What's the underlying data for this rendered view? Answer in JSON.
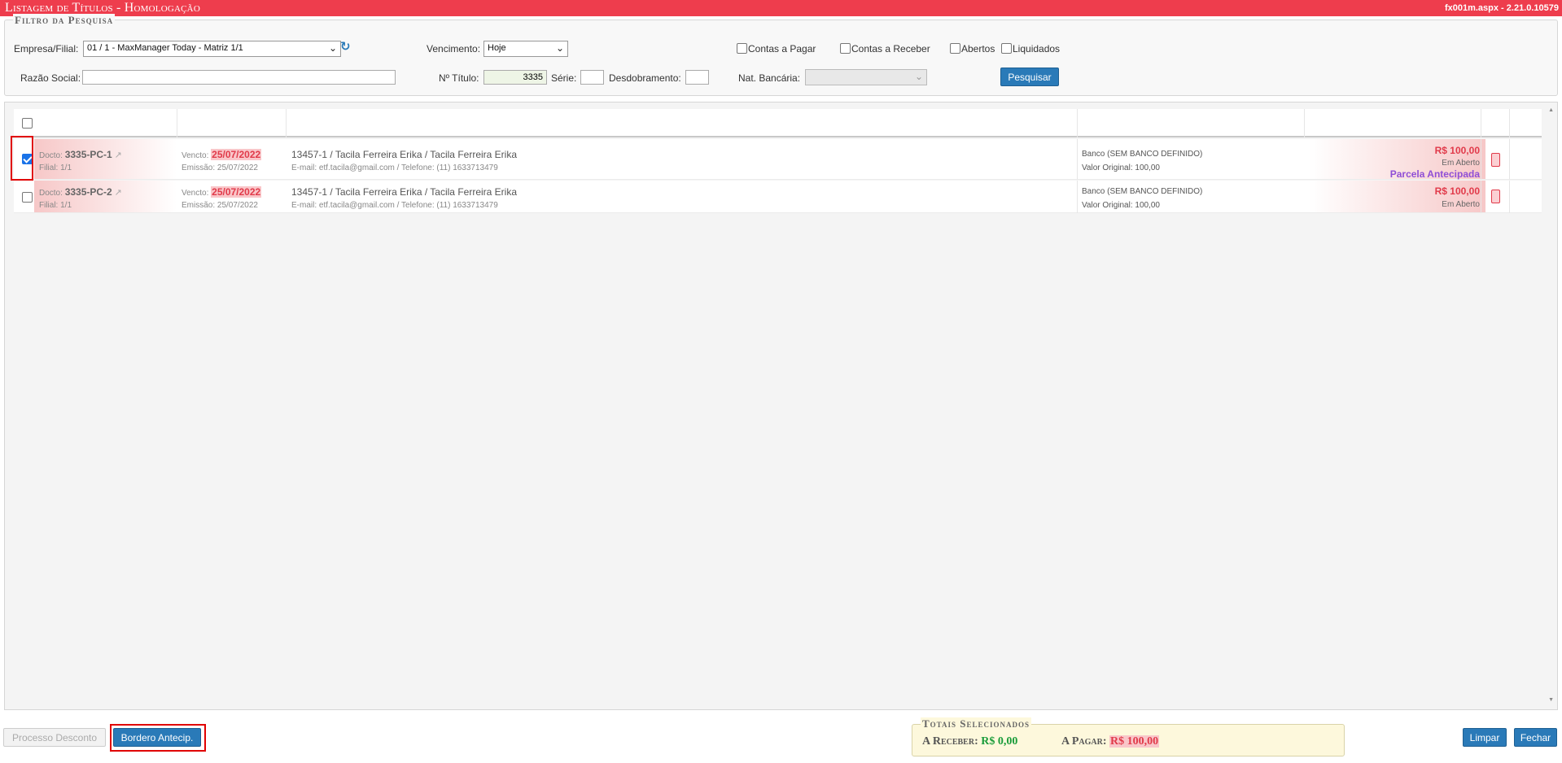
{
  "window": {
    "title": "Listagem de Títulos  - Homologação",
    "version": "fx001m.aspx - 2.21.0.10579"
  },
  "filter": {
    "legend": "Filtro da Pesquisa",
    "empresa_label": "Empresa/Filial:",
    "empresa_value": "01 / 1 - MaxManager Today - Matriz 1/1",
    "vencimento_label": "Vencimento:",
    "vencimento_value": "Hoje",
    "contas_pagar_label": "Contas a Pagar",
    "contas_receber_label": "Contas a Receber",
    "abertos_label": "Abertos",
    "liquidados_label": "Liquidados",
    "razao_label": "Razão Social:",
    "razao_value": "",
    "titulo_label": "Nº Título:",
    "titulo_value": "3335",
    "serie_label": "Série:",
    "serie_value": "",
    "desdobramento_label": "Desdobramento:",
    "desdobramento_value": "",
    "nat_bancaria_label": "Nat. Bancária:",
    "nat_bancaria_value": "",
    "pesquisar_label": "Pesquisar"
  },
  "rows": [
    {
      "selected": true,
      "docto_label": "Docto:",
      "docto": "3335-PC-1",
      "filial": "Filial: 1/1",
      "vencto_label": "Vencto:",
      "vencto": "25/07/2022",
      "emissao": "Emissão: 25/07/2022",
      "cliente": "13457-1 / Tacila Ferreira Erika / Tacila Ferreira Erika",
      "contato": "E-mail: etf.tacila@gmail.com / Telefone: (11) 1633713479",
      "banco": "Banco (SEM BANCO DEFINIDO)",
      "valor_original": "Valor Original: 100,00",
      "valor": "R$ 100,00",
      "status": "Em Aberto",
      "extra": "Parcela Antecipada"
    },
    {
      "selected": false,
      "docto_label": "Docto:",
      "docto": "3335-PC-2",
      "filial": "Filial: 1/1",
      "vencto_label": "Vencto:",
      "vencto": "25/07/2022",
      "emissao": "Emissão: 25/07/2022",
      "cliente": "13457-1 / Tacila Ferreira Erika / Tacila Ferreira Erika",
      "contato": "E-mail: etf.tacila@gmail.com / Telefone: (11) 1633713479",
      "banco": "Banco (SEM BANCO DEFINIDO)",
      "valor_original": "Valor Original: 100,00",
      "valor": "R$ 100,00",
      "status": "Em Aberto",
      "extra": ""
    }
  ],
  "footer": {
    "processo_desconto_label": "Processo Desconto",
    "bordero_label": "Bordero Antecip.",
    "totals_legend": "Totais Selecionados",
    "a_receber_label": "A Receber:",
    "a_receber_value": "R$ 0,00",
    "a_pagar_label": "A Pagar:",
    "a_pagar_value": "R$ 100,00",
    "limpar_label": "Limpar",
    "fechar_label": "Fechar"
  },
  "icons": {
    "refresh": "refresh-icon",
    "external_link": "external-link-icon",
    "delete": "trash-icon",
    "dropdown": "chevron-down-icon"
  },
  "colors": {
    "title_bar": "#ee3d4d",
    "primary_button": "#2a7ab8",
    "value_red": "#e13a4a",
    "value_green": "#1a9c3a",
    "highlight": "#8f4fd6"
  }
}
